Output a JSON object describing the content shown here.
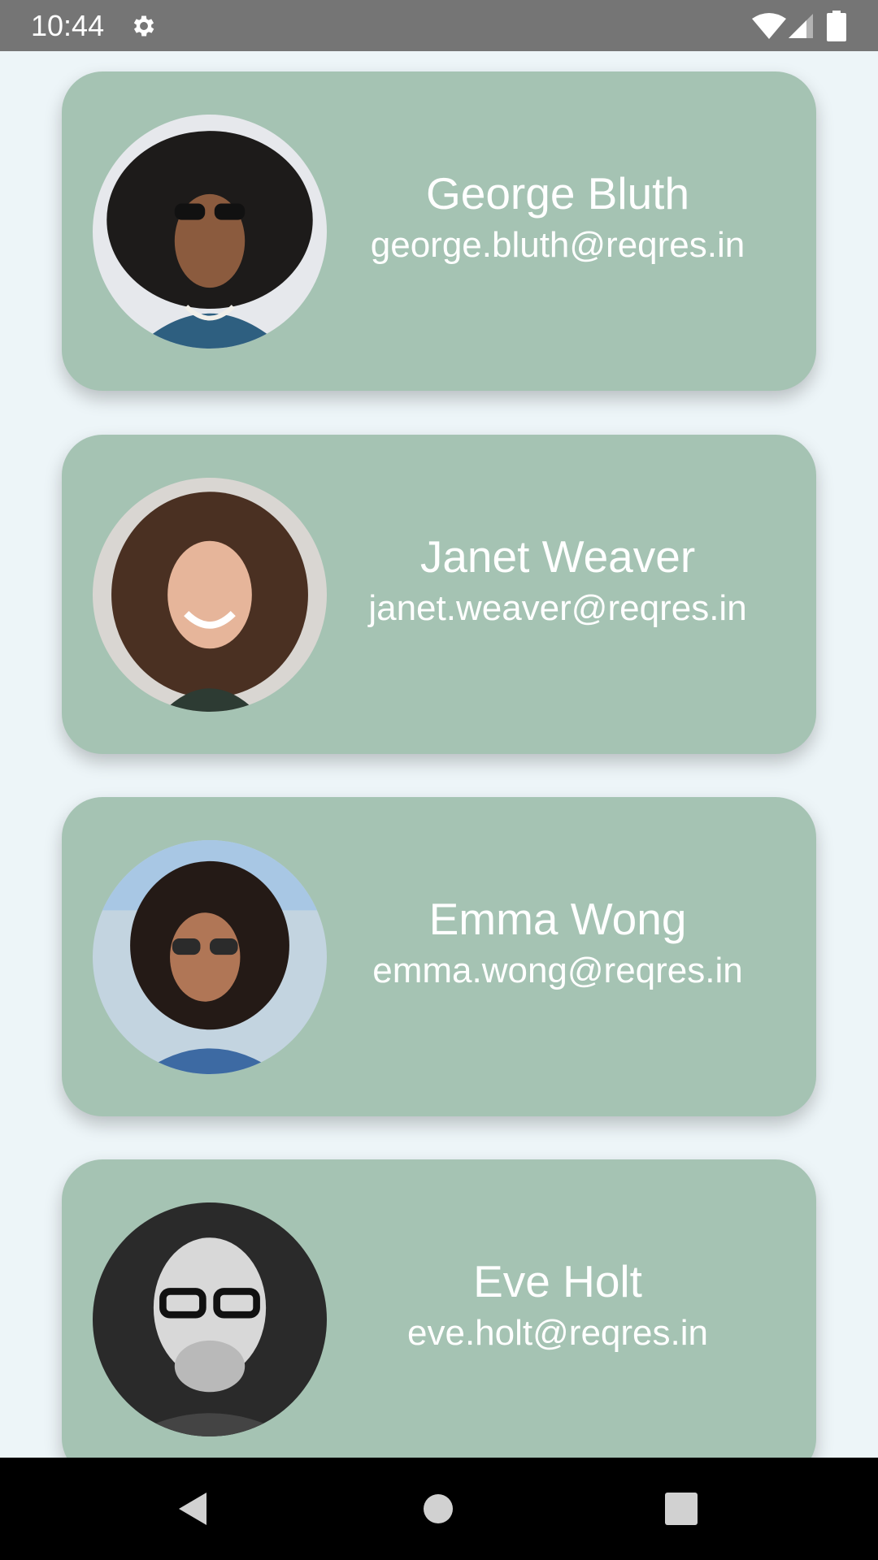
{
  "status_bar": {
    "time": "10:44",
    "icons": [
      "gear-icon",
      "wifi-icon",
      "cell-signal-icon",
      "battery-icon"
    ]
  },
  "users": [
    {
      "name": "George Bluth",
      "email": "george.bluth@reqres.in",
      "avatar": "avatar-photo"
    },
    {
      "name": "Janet Weaver",
      "email": "janet.weaver@reqres.in",
      "avatar": "avatar-photo"
    },
    {
      "name": "Emma Wong",
      "email": "emma.wong@reqres.in",
      "avatar": "avatar-photo"
    },
    {
      "name": "Eve Holt",
      "email": "eve.holt@reqres.in",
      "avatar": "avatar-photo"
    }
  ],
  "nav_bar": {
    "icons": [
      "back-icon",
      "home-icon",
      "recents-icon"
    ]
  },
  "colors": {
    "card": "#a5c3b3",
    "background": "#edf5f8",
    "status_bar": "#757575",
    "nav_bar": "#000000",
    "text": "#ffffff"
  }
}
